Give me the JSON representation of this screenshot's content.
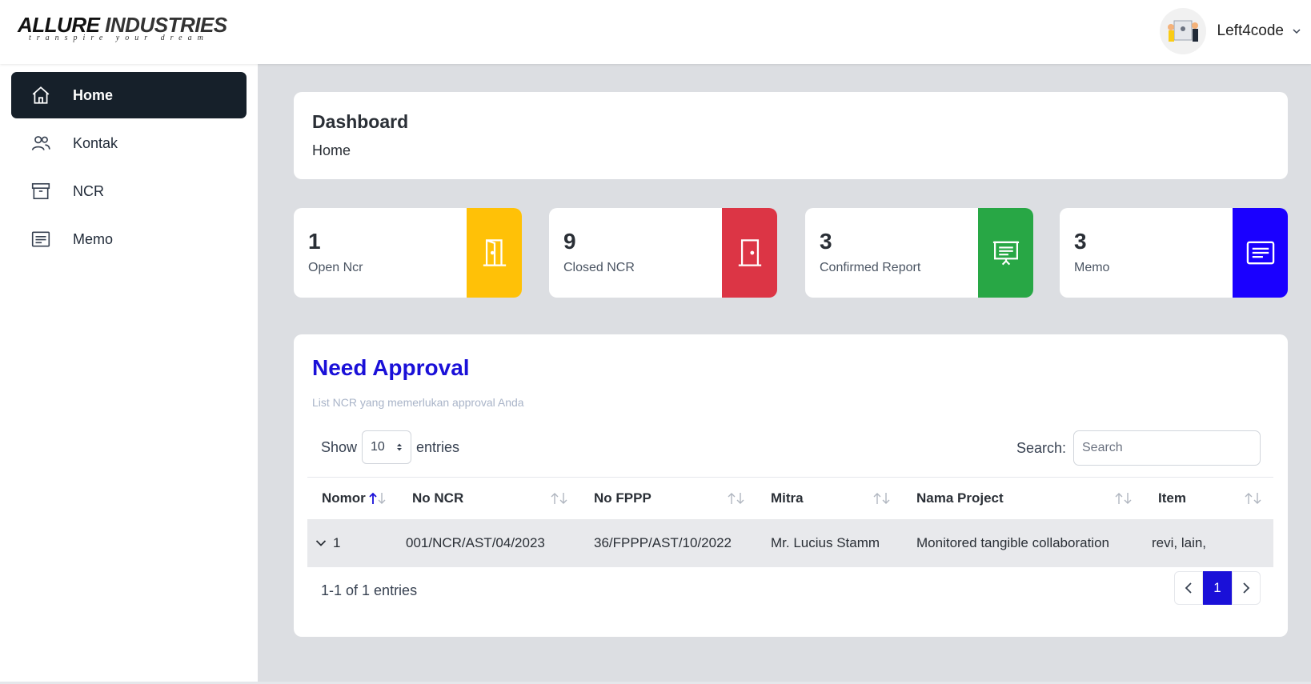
{
  "brand": {
    "logo_main_a": "ALLURE",
    "logo_main_b": "INDUSTRIES",
    "tagline": "transpire your dream"
  },
  "user": {
    "name": "Left4code"
  },
  "sidebar": {
    "items": [
      {
        "label": "Home",
        "icon": "home-icon",
        "active": true
      },
      {
        "label": "Kontak",
        "icon": "users-icon",
        "active": false
      },
      {
        "label": "NCR",
        "icon": "archive-icon",
        "active": false
      },
      {
        "label": "Memo",
        "icon": "memo-icon",
        "active": false
      }
    ]
  },
  "header": {
    "title": "Dashboard",
    "breadcrumb": "Home"
  },
  "stats": [
    {
      "value": "1",
      "label": "Open Ncr",
      "color": "#ffc107",
      "icon": "door-open-icon"
    },
    {
      "value": "9",
      "label": "Closed NCR",
      "color": "#dc3545",
      "icon": "door-closed-icon"
    },
    {
      "value": "3",
      "label": "Confirmed Report",
      "color": "#28a745",
      "icon": "presentation-icon"
    },
    {
      "value": "3",
      "label": "Memo",
      "color": "#1a00ff",
      "icon": "memo-icon"
    }
  ],
  "approval": {
    "title": "Need Approval",
    "subtitle": "List NCR yang memerlukan approval Anda",
    "show_label": "Show",
    "entries_value": "10",
    "entries_label": "entries",
    "search_label": "Search:",
    "search_placeholder": "Search",
    "columns": [
      "Nomor",
      "No NCR",
      "No FPPP",
      "Mitra",
      "Nama Project",
      "Item"
    ],
    "rows": [
      {
        "nomor": "1",
        "no_ncr": "001/NCR/AST/04/2023",
        "no_fppp": "36/FPPP/AST/10/2022",
        "mitra": "Mr. Lucius Stamm",
        "project": "Monitored tangible collaboration",
        "item": "revi, lain,"
      }
    ],
    "info": "1-1 of 1 entries",
    "current_page": "1"
  },
  "colors": {
    "accent": "#1a10d8",
    "sidebar_active": "#16202a",
    "main_bg": "#dcdee2"
  }
}
